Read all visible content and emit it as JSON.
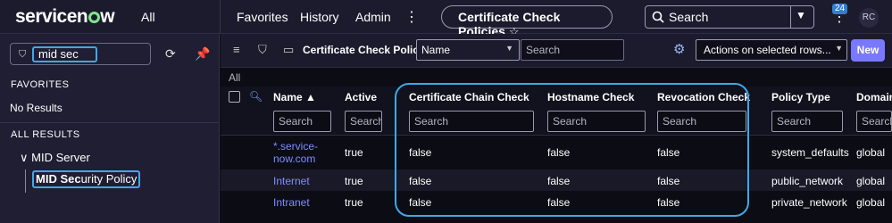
{
  "topbar": {
    "logo": "servicenow",
    "all_label": "All",
    "nav": [
      "Favorites",
      "History",
      "Admin"
    ],
    "title_pill": "Certificate Check Policies",
    "search_label": "Search",
    "notification_count": "24",
    "avatar_initials": "RC"
  },
  "sidebar": {
    "filter_value": "mid sec",
    "favorites_heading": "FAVORITES",
    "no_results": "No Results",
    "all_results_heading": "ALL RESULTS",
    "group_label": "MID Server",
    "result_match": "MID Sec",
    "result_rest": "urity Policy"
  },
  "list": {
    "title": "Certificate Check Policies",
    "field_select": "Name",
    "search_placeholder": "Search",
    "actions_label": "Actions on selected rows...",
    "new_label": "New",
    "breadcrumb": "All",
    "columns": [
      "Name",
      "Active",
      "Certificate Chain Check",
      "Hostname Check",
      "Revocation Check",
      "Policy Type",
      "Domain"
    ],
    "sort_indicator": "▲",
    "filter_placeholder": "Search",
    "rows": [
      {
        "name": "*.service-now.com",
        "active": "true",
        "chain": "false",
        "hostname": "false",
        "revocation": "false",
        "policy_type": "system_defaults",
        "domain": "global"
      },
      {
        "name": "Internet",
        "active": "true",
        "chain": "false",
        "hostname": "false",
        "revocation": "false",
        "policy_type": "public_network",
        "domain": "global"
      },
      {
        "name": "Intranet",
        "active": "true",
        "chain": "false",
        "hostname": "false",
        "revocation": "false",
        "policy_type": "private_network",
        "domain": "global"
      }
    ]
  },
  "colors": {
    "accent": "#7a78ff",
    "highlight": "#40a8e8",
    "link": "#7e8dff",
    "logo_ring": "#7ee787"
  }
}
